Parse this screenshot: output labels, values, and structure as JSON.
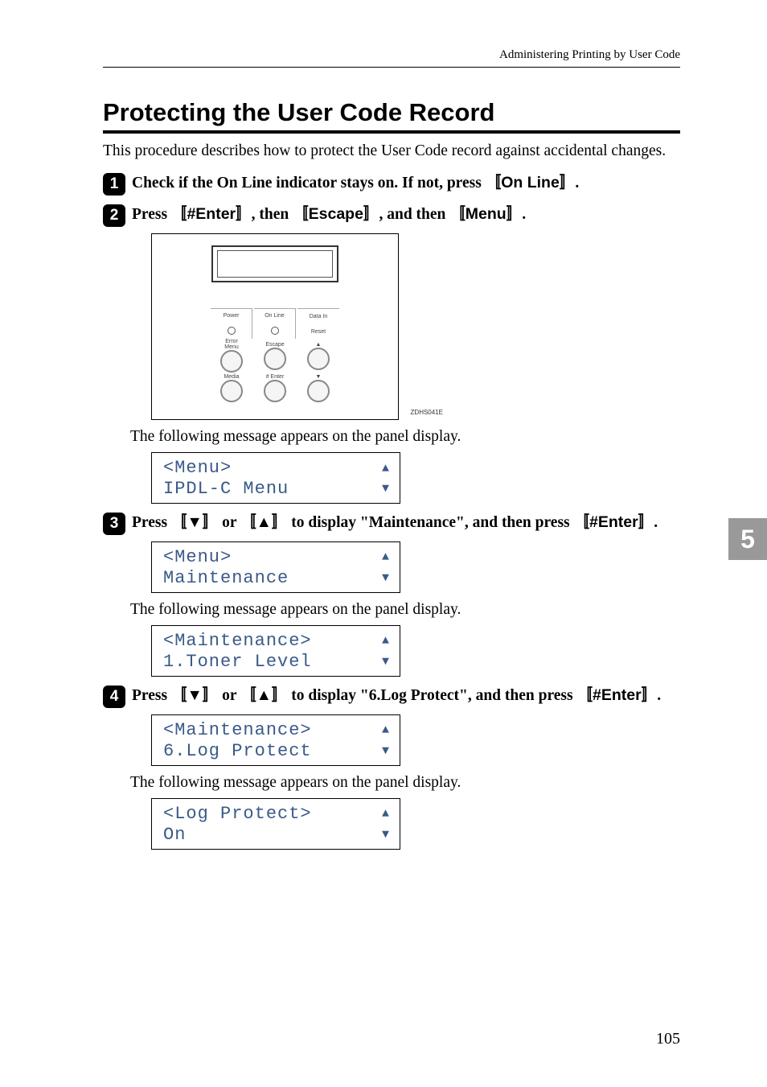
{
  "header": "Administering Printing by User Code",
  "title": "Protecting the User Code Record",
  "intro": "This procedure describes how to protect the User Code record against accidental changes.",
  "steps": {
    "s1": {
      "pre": "Check if the On Line indicator stays on. If not, press ",
      "k1": "On Line",
      "post": "."
    },
    "s2": {
      "p0": "Press ",
      "k1": "#Enter",
      "p1": ", then ",
      "k2": "Escape",
      "p2": ", and then ",
      "k3": "Menu",
      "p3": "."
    },
    "s3": {
      "p0": "Press ",
      "k1": "▼",
      "p1": " or ",
      "k2": "▲",
      "p2": " to display \"Maintenance\", and then press ",
      "k3": "#Enter",
      "p3": "."
    },
    "s4": {
      "p0": "Press ",
      "k1": "▼",
      "p1": " or ",
      "k2": "▲",
      "p2": " to display \"6.Log Protect\", and then press ",
      "k3": "#Enter",
      "p3": "."
    }
  },
  "panel_img": {
    "labels": {
      "power": "Power",
      "online": "On Line",
      "datain": "Data In",
      "reset": "Reset",
      "error": "Error",
      "menu": "Menu",
      "escape": "Escape",
      "media": "Media",
      "enter": "# Enter"
    },
    "code": "ZDHS041E"
  },
  "msg_after_panel": "The following message appears on the panel display.",
  "lcd1": {
    "l1": "<Menu>",
    "l2": " IPDL-C Menu"
  },
  "lcd2": {
    "l1": "<Menu>",
    "l2": " Maintenance"
  },
  "msg_after_lcd2": "The following message appears on the panel display.",
  "lcd3": {
    "l1": "<Maintenance>",
    "l2": "  1.Toner Level"
  },
  "lcd4": {
    "l1": "<Maintenance>",
    "l2": "  6.Log Protect"
  },
  "msg_after_lcd4": "The following message appears on the panel display.",
  "lcd5": {
    "l1": "<Log Protect>",
    "l2": " On"
  },
  "tab": "5",
  "page": "105"
}
